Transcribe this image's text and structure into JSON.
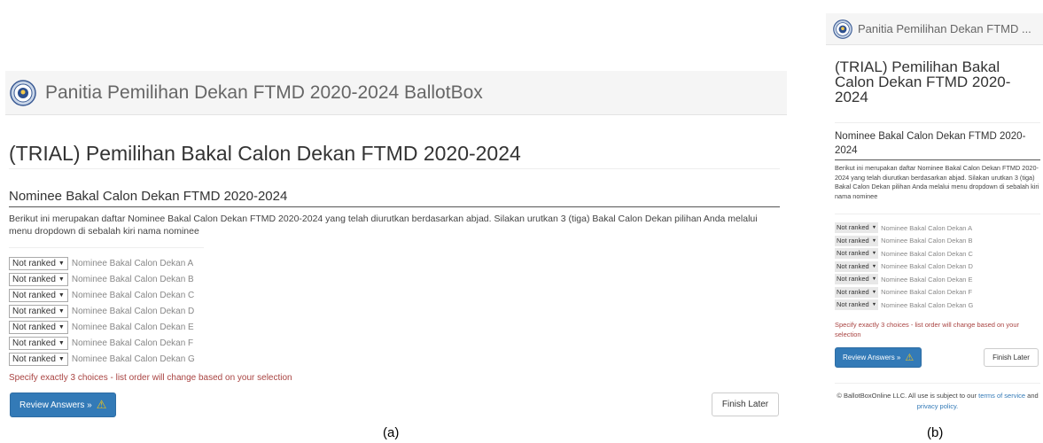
{
  "brand": {
    "full_name": "Panitia Pemilihan Dekan FTMD 2020-2024 BallotBox",
    "short_name": "Panitia Pemilihan Dekan FTMD ..."
  },
  "election_title": "(TRIAL) Pemilihan Bakal Calon Dekan FTMD 2020-2024",
  "section_title": "Nominee Bakal Calon Dekan FTMD 2020-2024",
  "description": "Berikut ini merupakan daftar Nominee Bakal Calon Dekan FTMD 2020-2024 yang telah diurutkan berdasarkan abjad. Silakan urutkan 3 (tiga) Bakal Calon Dekan pilihan Anda melalui menu dropdown di sebalah kiri nama nominee",
  "rank_select_value": "Not ranked",
  "nominees": [
    "Nominee Bakal Calon Dekan A",
    "Nominee Bakal Calon Dekan B",
    "Nominee Bakal Calon Dekan C",
    "Nominee Bakal Calon Dekan D",
    "Nominee Bakal Calon Dekan E",
    "Nominee Bakal Calon Dekan F",
    "Nominee Bakal Calon Dekan G"
  ],
  "validation_message": "Specify exactly 3 choices - list order will change based on your selection",
  "buttons": {
    "review": "Review Answers »",
    "finish_later": "Finish Later"
  },
  "footer": {
    "prefix": "© BallotBoxOnline LLC. All use is subject to our",
    "terms_link": "terms of service",
    "and": "and",
    "privacy_link": "privacy policy."
  },
  "captions": {
    "a": "(a)",
    "b": "(b)"
  },
  "colors": {
    "primary": "#337ab7",
    "warning_text": "#a94442",
    "warning_icon": "#f0c419"
  },
  "icons": [
    "ballotbox-logo-icon",
    "warning-triangle-icon",
    "dropdown-arrow-icon"
  ]
}
